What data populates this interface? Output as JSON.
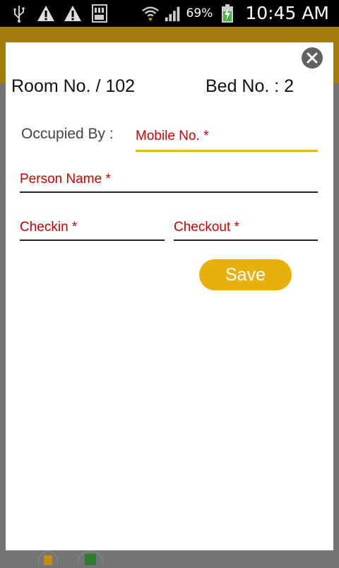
{
  "status_bar": {
    "battery_percent": "69%",
    "time": "10:45 AM",
    "icons": [
      "usb-icon",
      "warning-icon",
      "warning-icon",
      "sd-card-icon",
      "wifi-icon",
      "signal-icon",
      "battery-charging-icon"
    ]
  },
  "dialog": {
    "room_label": "Room No. / 102",
    "bed_label": "Bed No. : 2",
    "occupied_label": "Occupied By :",
    "fields": {
      "mobile_placeholder": "Mobile No. *",
      "person_placeholder": "Person Name *",
      "checkin_placeholder": "Checkin *",
      "checkout_placeholder": "Checkout *"
    },
    "save_label": "Save"
  },
  "colors": {
    "accent": "#e8b00b",
    "appbar": "#a27d0c",
    "placeholder": "#c40000",
    "close_bg": "#616161"
  }
}
